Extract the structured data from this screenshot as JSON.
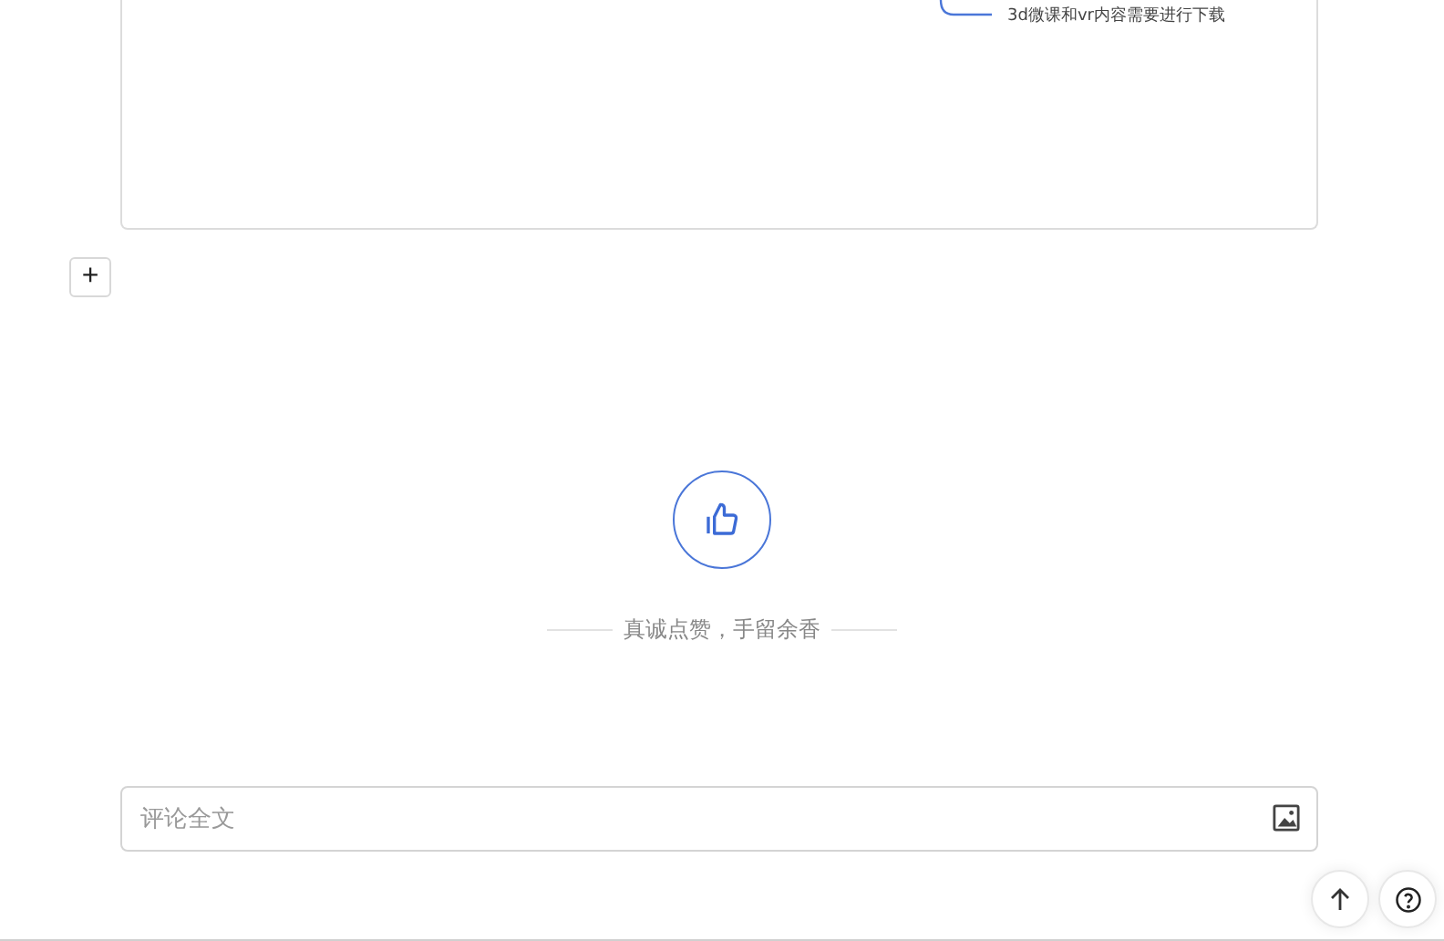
{
  "embedded_image": {
    "caption": "3d微课和vr内容需要进行下载"
  },
  "add_button": {
    "label": "+"
  },
  "like": {
    "caption": "真诚点赞，手留余香"
  },
  "comment": {
    "placeholder": "评论全文"
  }
}
